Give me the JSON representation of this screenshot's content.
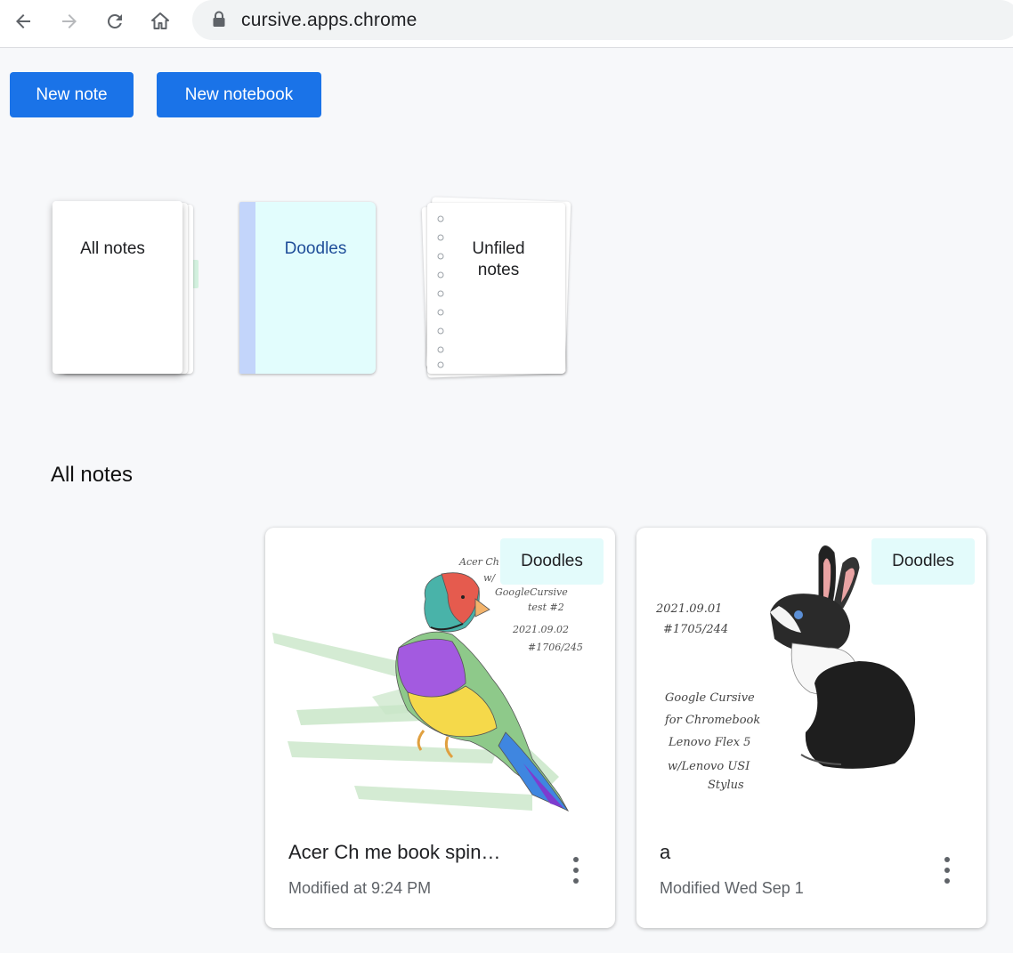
{
  "browser": {
    "url": "cursive.apps.chrome",
    "icons": [
      "back-icon",
      "forward-icon",
      "reload-icon",
      "home-icon",
      "lock-icon"
    ]
  },
  "toolbar": {
    "new_note_label": "New note",
    "new_notebook_label": "New notebook"
  },
  "notebooks": [
    {
      "label": "All notes"
    },
    {
      "label": "Doodles",
      "color": "#e2fdfd",
      "spine_color": "#c3d5fb"
    },
    {
      "label": "Unfiled notes"
    }
  ],
  "section": {
    "title": "All notes"
  },
  "notes": [
    {
      "notebook_chip": "Doodles",
      "title": "Acer Ch me book spin…",
      "modified": "Modified at 9:24 PM",
      "thumbnail": "bird-sketch",
      "handwriting": [
        "Acer Ch",
        "w/",
        "GoogleCursive",
        "test #2",
        "2021.09.02",
        "#1706/245"
      ]
    },
    {
      "notebook_chip": "Doodles",
      "title": "a",
      "modified": "Modified Wed Sep 1",
      "thumbnail": "rabbit-sketch",
      "handwriting": [
        "2021.09.01",
        "#1705/244",
        "Google Cursive",
        "for Chromebook",
        "Lenovo Flex 5",
        "w/Lenovo USI",
        "Stylus"
      ]
    }
  ],
  "colors": {
    "accent": "#1a73e8",
    "chip_bg": "#e3fbfb",
    "notebook_text": "#1f4e99"
  }
}
